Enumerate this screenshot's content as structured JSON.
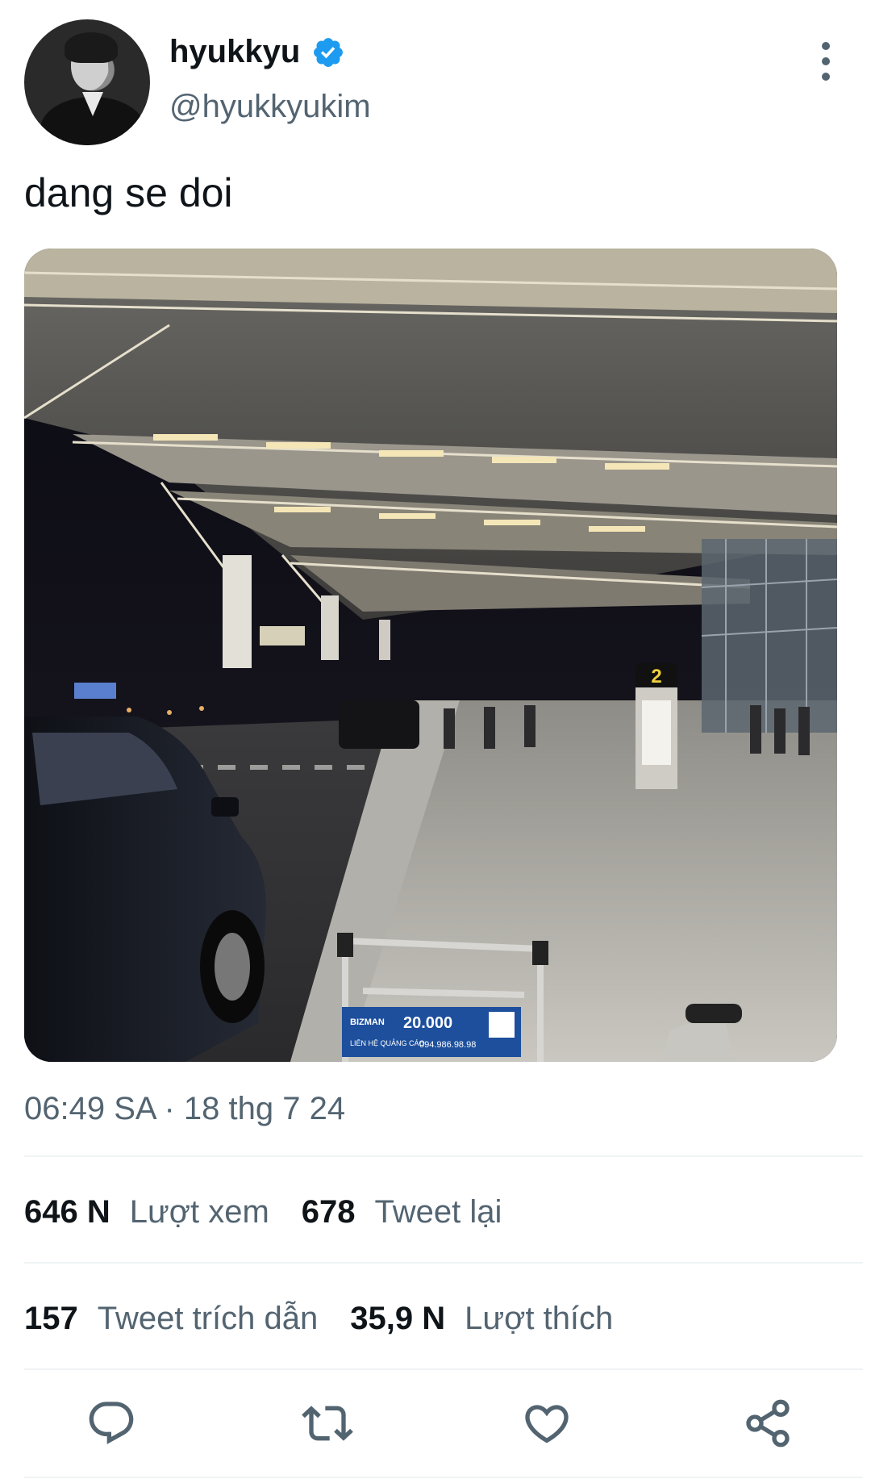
{
  "author": {
    "display_name": "hyukkyu",
    "handle": "@hyukkyukim",
    "verified": true
  },
  "tweet": {
    "text": "dang se doi",
    "timestamp": "06:49 SA · 18 thg 7 24",
    "photo": {
      "cart_sign_brand": "BIZMAN",
      "cart_sign_price": "20.000",
      "cart_sign_contact": "LIÊN HỆ QUẢNG CÁO",
      "cart_sign_phone": "094.986.98.98",
      "gate_number": "2"
    }
  },
  "stats": {
    "views_value": "646 N",
    "views_label": "Lượt xem",
    "retweets_value": "678",
    "retweets_label": "Tweet lại",
    "quotes_value": "157",
    "quotes_label": "Tweet trích dẫn",
    "likes_value": "35,9 N",
    "likes_label": "Lượt thích"
  },
  "icons": {
    "more": "more-vertical-icon",
    "verified": "verified-badge-icon",
    "reply": "reply-icon",
    "retweet": "retweet-icon",
    "like": "heart-icon",
    "share": "share-icon"
  },
  "colors": {
    "verified_blue": "#1d9bf0",
    "secondary_text": "#536471",
    "primary_text": "#0f1419"
  }
}
